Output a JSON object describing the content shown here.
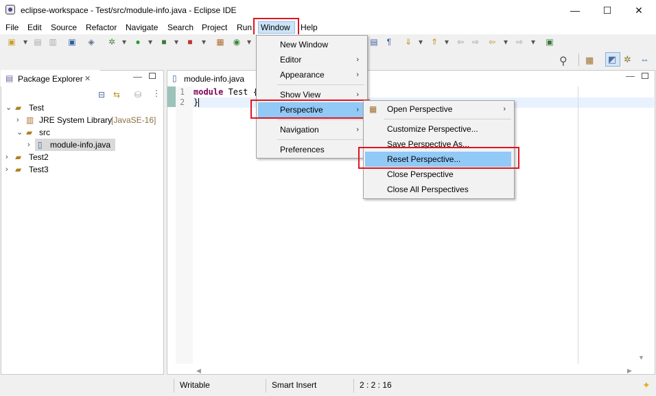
{
  "window": {
    "title": "eclipse-workspace - Test/src/module-info.java - Eclipse IDE",
    "minimize": "—",
    "maximize": "☐",
    "close": "✕"
  },
  "menubar": {
    "items": [
      "File",
      "Edit",
      "Source",
      "Refactor",
      "Navigate",
      "Search",
      "Project",
      "Run",
      "Window",
      "Help"
    ]
  },
  "package_explorer": {
    "title": "Package Explorer",
    "tree": [
      {
        "label": "Test",
        "expanded": true
      },
      {
        "label": "JRE System Library",
        "suffix": "[JavaSE-16]"
      },
      {
        "label": "src",
        "expanded": true
      },
      {
        "label": "module-info.java",
        "selected": true
      },
      {
        "label": "Test2"
      },
      {
        "label": "Test3"
      }
    ]
  },
  "editor": {
    "tab_label": "module-info.java",
    "line_numbers": [
      "1",
      "2"
    ],
    "line1_keyword": "module",
    "line1_rest": " Test {",
    "line2": "}"
  },
  "window_menu": {
    "items": [
      "New Window",
      "Editor",
      "Appearance",
      "Show View",
      "Perspective",
      "Navigation",
      "Preferences"
    ]
  },
  "perspective_menu": {
    "items": [
      "Open Perspective",
      "Customize Perspective...",
      "Save Perspective As...",
      "Reset Perspective...",
      "Close Perspective",
      "Close All Perspectives"
    ]
  },
  "status": {
    "writable": "Writable",
    "insert_mode": "Smart Insert",
    "position": "2 : 2 : 16"
  },
  "colors": {
    "highlight": "#91c9f7",
    "annotation_red": "#e0141e",
    "keyword": "#7f0055"
  }
}
